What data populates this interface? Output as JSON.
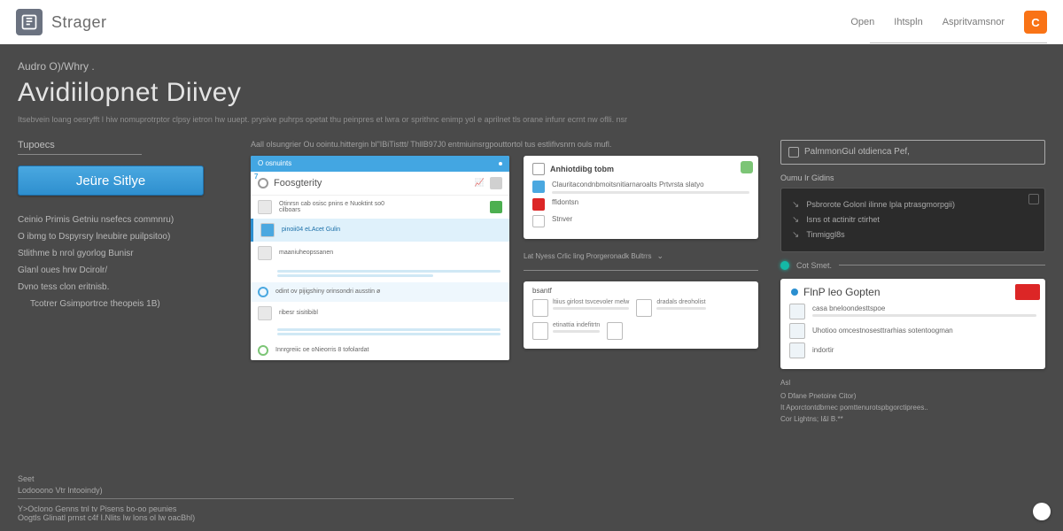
{
  "brand": "Strager",
  "topnav": {
    "a": "Open",
    "b": "Ihtspln",
    "c": "Aspritvamsnor",
    "btn": "C"
  },
  "breadcrumb": "Audro O)/Whry .",
  "title": "Avidiilopnet Diivey",
  "subtitle": "Itsebvein loang oesryfft l hiw nomuprotrptor clpsy ietron hw uuept. prysive puhrps opetat thu peinpres et lwra or sprithnc enimp yol e aprilnet tls orane infunr ecrnt nw oflli. nsr",
  "left": {
    "label": "Tupoecs",
    "cta": "Jeüre Sitlye",
    "links": [
      "Ceinio Primis Getniu nsefecs commnru)",
      "O ibmg to  Dspyrsry lneubire puilpsitoo)",
      "Stlithme b nrol gyorlog Bunisr",
      "Glanl oues hrw Dcirolr/",
      "Dvno tess clon eritnisb.",
      "Tcotrer Gsimportrce theopeis  1B)"
    ]
  },
  "mid": {
    "intro": "Aall olsungrier Ou oointu.hittergin bl\"IBiTisttt/ ThllB97J0 entmiuinsrgpouttortol tus estlifivsnrn ouls mufl.",
    "cardA": {
      "topLabel": "O osnuints",
      "title": "Foosgterity",
      "rows": [
        "Otinrsn cab osisc pnins e Nuoktint so0",
        "cilboars",
        "pinoii04 eLAcet Gulin",
        "maaniuheopssanen",
        "odint ov pijigshiny orinsondri ausstin ø",
        "ribesr sisitibibl",
        "Innrgreiic oe oNieorris 8 tofolardat"
      ]
    },
    "cardB": {
      "title": "Anhiotdibg tobm",
      "rows": [
        "Clauritacondnbmoitsnitiarnaroalts Prtvrsta slatyo",
        "ffidontsn",
        "Stnver"
      ]
    },
    "caption": "Lat Nyess Crlic ling Prorgeronadk Bultrrs",
    "cardBottom": {
      "label": "bsantf",
      "items": [
        "ltiius girlost tsvcevoler melw",
        "dradals dreoholist",
        "etinattia indefitrtn"
      ]
    }
  },
  "right": {
    "search": "PalmmonGul otdienca  Pef,",
    "darkTitle": "Oumu Ir Gidins",
    "darkRows": [
      "Psbrorote Golonl ilinne lpla ptrasgmorpgii)",
      "Isns ot actinitr ctirhet",
      "Tinmiggl8s"
    ],
    "track": "Cot Smet.",
    "cardR": {
      "title": "FlnP leo Gopten",
      "lines": [
        "casa bneloondesttspoe",
        "Uhotioo omcestnosesttrarhias sotentoogman",
        "indortir"
      ]
    },
    "footLabel": "Asl",
    "footRows": [
      "O Dfane Pnetoine Citor)",
      "It Aporctontdbrnec pomttenurotspbgorctiprees..",
      "Cor Lightns; I&l B.**"
    ]
  },
  "footer": {
    "sec": "Seet",
    "a": "Lodooono Vtr lntooindy)",
    "b": "Y>Oclono Genns tnl tv Pisens bo-oo peunies",
    "c": "Oogtls Glinatl prnst c4f I.Nlits Iw lons ol lw oacBhl)"
  }
}
